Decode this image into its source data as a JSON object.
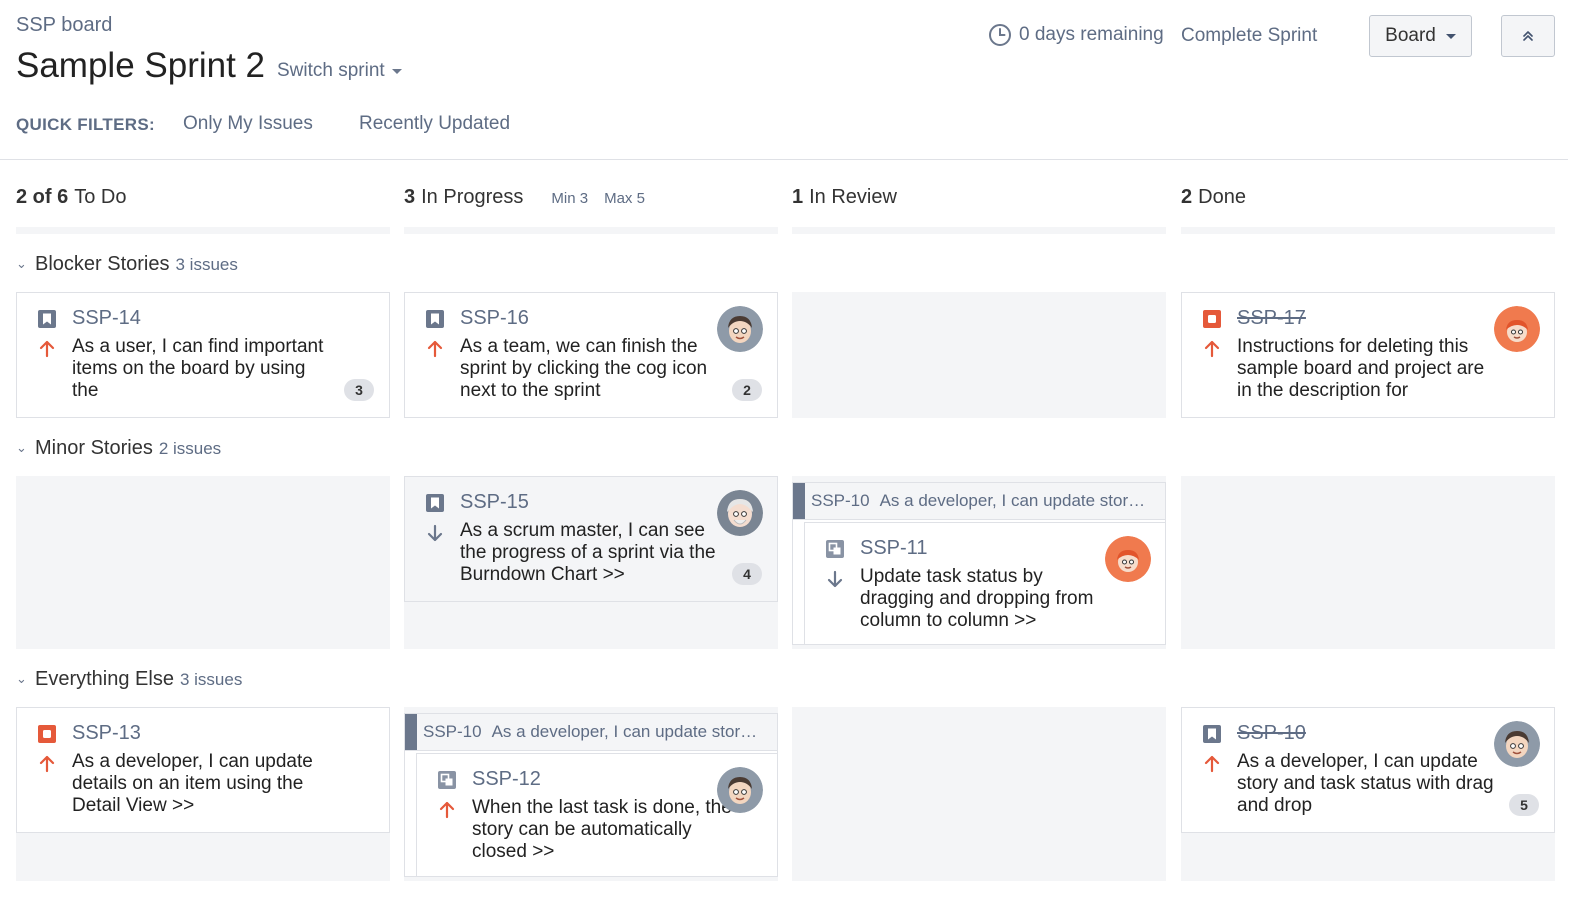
{
  "header": {
    "board_name": "SSP board",
    "sprint_name": "Sample Sprint 2",
    "switch_sprint": "Switch sprint",
    "remaining": "0 days remaining",
    "complete_sprint": "Complete Sprint",
    "view_button": "Board"
  },
  "quick_filters": {
    "label": "QUICK FILTERS:",
    "items": [
      "Only My Issues",
      "Recently Updated"
    ]
  },
  "columns": [
    {
      "count": "2 of 6",
      "name": "To Do"
    },
    {
      "count": "3",
      "name": "In Progress",
      "min": "Min 3",
      "max": "Max 5"
    },
    {
      "count": "1",
      "name": "In Review"
    },
    {
      "count": "2",
      "name": "Done"
    }
  ],
  "swimlanes": [
    {
      "title": "Blocker Stories",
      "count": "3 issues",
      "cards": {
        "ssp14": {
          "key": "SSP-14",
          "summary": "As a user, I can find important items on the board by using the",
          "estimate": "3",
          "type": "story-icon",
          "priority": "high-priority-icon"
        },
        "ssp16": {
          "key": "SSP-16",
          "summary": "As a team, we can finish the sprint by clicking the cog icon next to the sprint",
          "estimate": "2",
          "type": "story-icon",
          "priority": "high-priority-icon"
        },
        "ssp17": {
          "key": "SSP-17",
          "summary": "Instructions for deleting this sample board and project are in the description for",
          "type": "bug-icon",
          "priority": "high-priority-icon"
        }
      }
    },
    {
      "title": "Minor Stories",
      "count": "2 issues",
      "cards": {
        "ssp15": {
          "key": "SSP-15",
          "summary": "As a scrum master, I can see the progress of a sprint via the Burndown Chart >>",
          "estimate": "4",
          "type": "story-icon",
          "priority": "low-priority-icon"
        },
        "parent": {
          "key": "SSP-10",
          "summary": "As a developer, I can update stor…"
        },
        "ssp11": {
          "key": "SSP-11",
          "summary": "Update task status by dragging and dropping from column to column >>",
          "type": "subtask-icon",
          "priority": "low-priority-icon"
        }
      }
    },
    {
      "title": "Everything Else",
      "count": "3 issues",
      "cards": {
        "ssp13": {
          "key": "SSP-13",
          "summary": "As a developer, I can update details on an item using the Detail View >>",
          "type": "bug-icon",
          "priority": "high-priority-icon"
        },
        "parent": {
          "key": "SSP-10",
          "summary": "As a developer, I can update stor…"
        },
        "ssp12": {
          "key": "SSP-12",
          "summary": "When the last task is done, the story can be automatically closed >>",
          "type": "subtask-icon",
          "priority": "high-priority-icon"
        },
        "ssp10": {
          "key": "SSP-10",
          "summary": "As a developer, I can update story and task status with drag and drop",
          "estimate": "5",
          "type": "story-icon",
          "priority": "high-priority-icon"
        }
      }
    }
  ],
  "colors": {
    "story": "#6b778c",
    "bug": "#e5593a",
    "priority_high": "#e5593a",
    "priority_low": "#6b778c",
    "column_background": "#f4f5f7"
  }
}
